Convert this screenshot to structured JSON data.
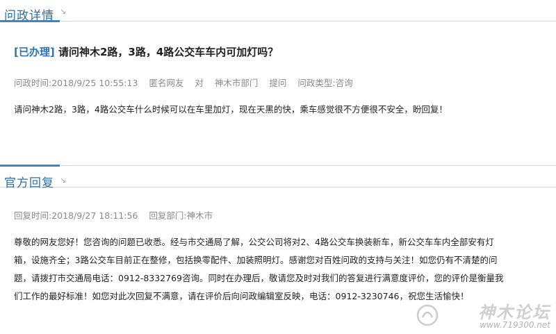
{
  "inquiry_section": {
    "title": "问政详情"
  },
  "question": {
    "status_badge": "[已办理]",
    "title": "请问神木2路，3路，4路公交车车内可加灯吗？",
    "meta": {
      "time": "问政时间:2018/9/25 10:55:13",
      "author": "匿名网友",
      "to_word": "对",
      "department": "神木市部门",
      "action": "提问",
      "type": "问政类型:咨询"
    },
    "content": "请问神木2路，3路，4路公交车什么时候可以在车里加灯，现在天黑的快，乘车感觉很不方便很不安全，盼回复！"
  },
  "reply_section": {
    "title": "官方回复"
  },
  "reply": {
    "meta": {
      "time": "回复时间:2018/9/27 18:11:56",
      "department": "回复部门:神木市"
    },
    "lines": [
      "尊敬的网友您好！您咨询的问题已收悉。经与市交通局了解，公交公司将对2、4路公交车换装新车，新公交车车内全部安有灯",
      "箱，设施齐全；3路公交车目前正在整修，包括换零配件、加装照明灯。感谢您对百姓问政的支持与关注！如您仍有不清楚的问",
      "题，请拨打市交通局电话：0912-8332769咨询。同时在办理后，敬请您及时对我们的答复进行满意度评价，您的评价是衡量我",
      "们工作的最好标准！如您对此次回复不满意，请在评价后向问政编辑室反映，电话：0912-3230746，祝您生活愉快！"
    ]
  },
  "watermark": {
    "name": "神木论坛",
    "url": "www.719300.net"
  }
}
